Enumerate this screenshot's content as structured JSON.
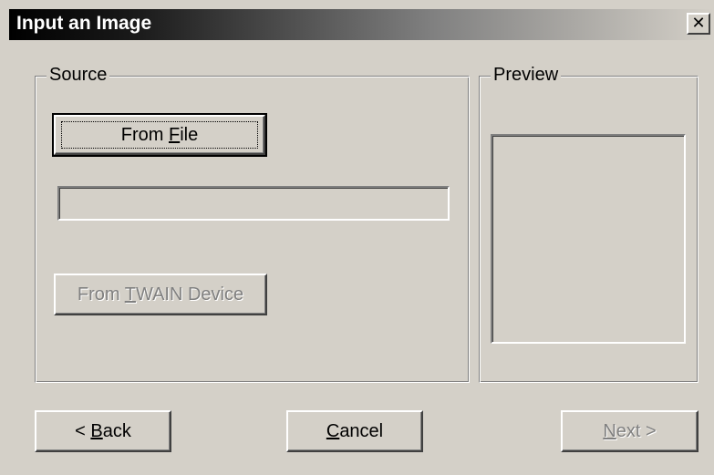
{
  "window": {
    "title": "Input an Image",
    "close_glyph": "✕"
  },
  "source_group": {
    "label": "Source"
  },
  "preview_group": {
    "label": "Preview"
  },
  "buttons": {
    "from_file": {
      "pre": "From ",
      "mnemonic": "F",
      "post": "ile"
    },
    "from_twain": {
      "pre": "From ",
      "mnemonic": "T",
      "post": "WAIN Device"
    },
    "back": {
      "pre": "< ",
      "mnemonic": "B",
      "post": "ack"
    },
    "cancel": {
      "pre": "",
      "mnemonic": "C",
      "post": "ancel"
    },
    "next": {
      "pre": "",
      "mnemonic": "N",
      "post": "ext >"
    }
  },
  "file_path": {
    "value": ""
  },
  "icons": {
    "close": "close-icon"
  }
}
